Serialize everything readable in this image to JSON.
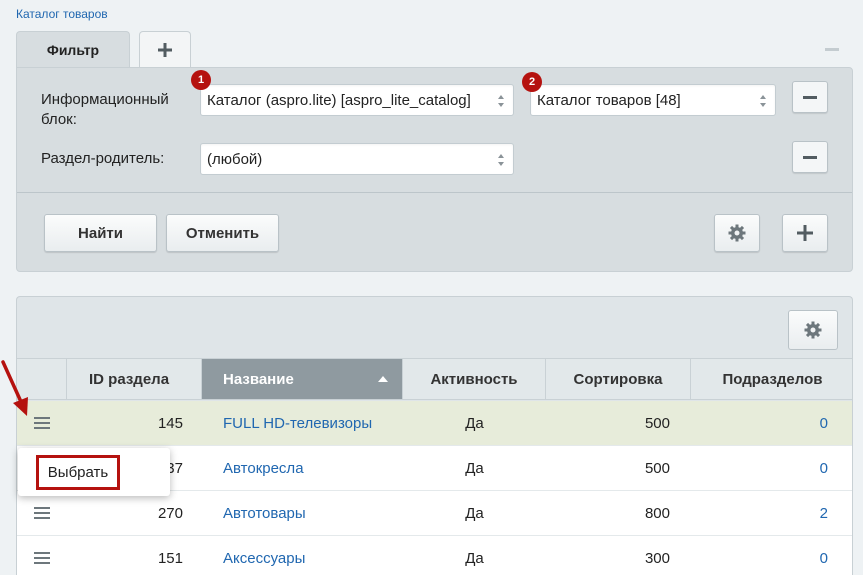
{
  "breadcrumb": "Каталог товаров",
  "filter": {
    "tab_label": "Фильтр",
    "iblock_label": "Информационный блок:",
    "iblock_select_value": "Каталог (aspro.lite) [aspro_lite_catalog]",
    "iblock_badge": "1",
    "catalog_select_value": "Каталог товаров [48]",
    "catalog_badge": "2",
    "parent_label": "Раздел-родитель:",
    "parent_select_value": "(любой)",
    "find_button": "Найти",
    "cancel_button": "Отменить"
  },
  "grid": {
    "columns": [
      "ID раздела",
      "Название",
      "Активность",
      "Сортировка",
      "Подразделов"
    ],
    "sorted_column": "Название",
    "rows": [
      {
        "id": "145",
        "name": "FULL HD-телевизоры",
        "active": "Да",
        "sort": "500",
        "subsections": "0"
      },
      {
        "id": "137",
        "name": "Автокресла",
        "active": "Да",
        "sort": "500",
        "subsections": "0"
      },
      {
        "id": "270",
        "name": "Автотовары",
        "active": "Да",
        "sort": "800",
        "subsections": "2"
      },
      {
        "id": "151",
        "name": "Аксессуары",
        "active": "Да",
        "sort": "300",
        "subsections": "0"
      }
    ]
  },
  "context_menu": {
    "item": "Выбрать"
  },
  "colors": {
    "link": "#2067b0",
    "annotation_red": "#b5120f",
    "highlight_row": "#e7ecda",
    "sorted_header": "#8f9aa0"
  }
}
